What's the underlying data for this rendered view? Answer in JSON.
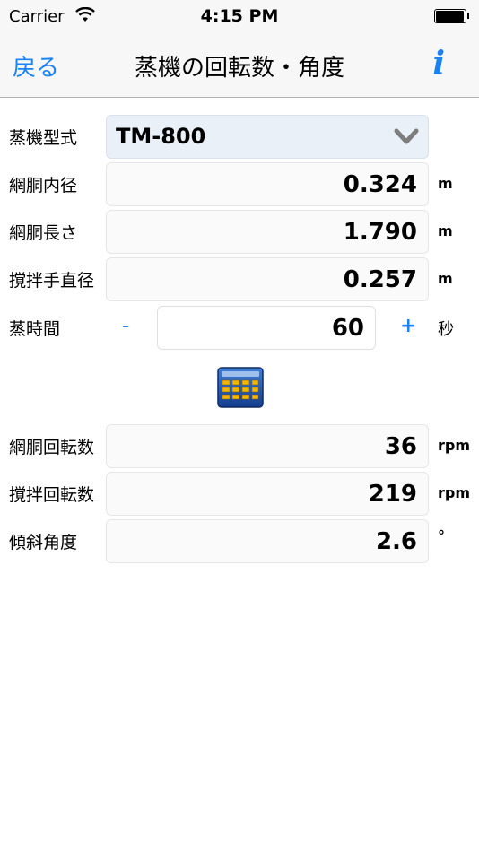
{
  "status_bar": {
    "carrier": "Carrier",
    "time": "4:15 PM"
  },
  "nav": {
    "back_label": "戻る",
    "title": "蒸機の回転数・角度",
    "info_label": "i"
  },
  "form": {
    "model": {
      "label": "蒸機型式",
      "value": "TM-800"
    },
    "drum_diameter": {
      "label": "網胴内径",
      "value": "0.324",
      "unit": "m"
    },
    "drum_length": {
      "label": "網胴長さ",
      "value": "1.790",
      "unit": "m"
    },
    "agitator_diameter": {
      "label": "撹拌手直径",
      "value": "0.257",
      "unit": "m"
    },
    "steam_time": {
      "label": "蒸時間",
      "minus": "-",
      "value": "60",
      "plus": "+",
      "unit": "秒"
    }
  },
  "results": {
    "drum_rpm": {
      "label": "網胴回転数",
      "value": "36",
      "unit": "rpm"
    },
    "agitator_rpm": {
      "label": "撹拌回転数",
      "value": "219",
      "unit": "rpm"
    },
    "tilt_angle": {
      "label": "傾斜角度",
      "value": "2.6",
      "unit": "°"
    }
  },
  "icons": {
    "calculate": "calculator-icon",
    "select": "chevron-down-icon",
    "wifi": "wifi-icon",
    "battery": "battery-icon"
  },
  "colors": {
    "accent": "#1a82f4",
    "bar_bg": "#f7f7f7"
  }
}
